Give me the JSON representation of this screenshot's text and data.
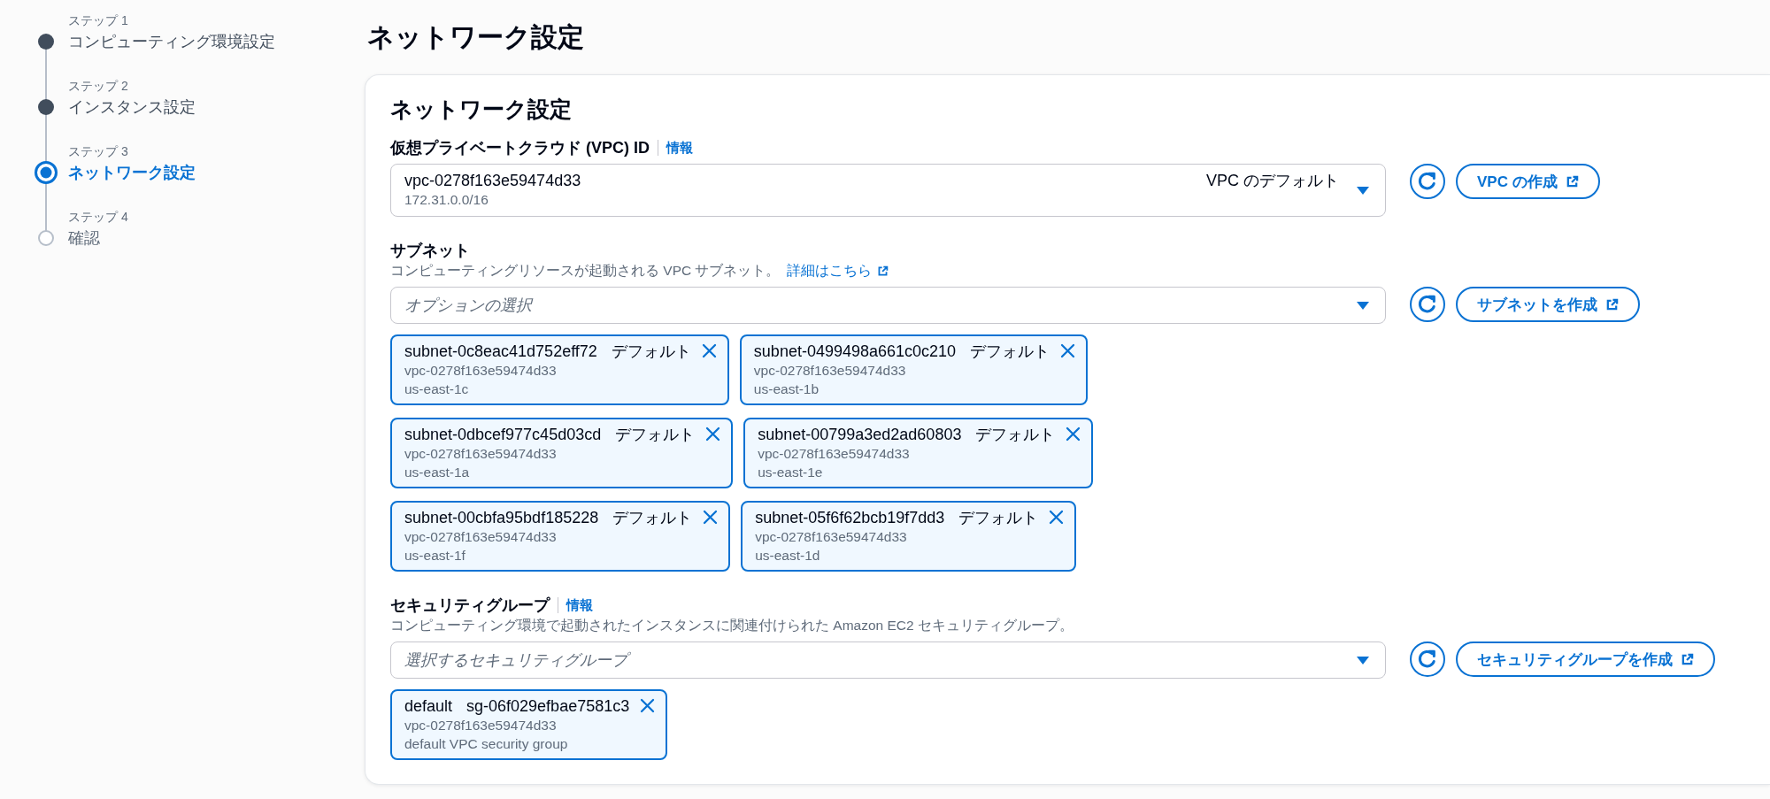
{
  "steps": [
    {
      "label": "ステップ 1",
      "title": "コンピューティング環境設定",
      "completed": true,
      "selected": false
    },
    {
      "label": "ステップ 2",
      "title": "インスタンス設定",
      "completed": true,
      "selected": false
    },
    {
      "label": "ステップ 3",
      "title": "ネットワーク設定",
      "completed": false,
      "selected": true
    },
    {
      "label": "ステップ 4",
      "title": "確認",
      "completed": false,
      "selected": false
    }
  ],
  "page_title": "ネットワーク設定",
  "panel": {
    "title": "ネットワーク設定",
    "fields": [
      {
        "label": "仮想プライベートクラウド (VPC) ID",
        "info_link": "情報",
        "select": {
          "value": "vpc-0278f163e59474d33",
          "value_description": "172.31.0.0/16",
          "value_tag": "VPC のデフォルト"
        },
        "create_button": "VPC の作成"
      },
      {
        "label": "サブネット",
        "description": "コンピューティングリソースが起動される VPC サブネット。",
        "description_link": "詳細はこちら",
        "select": {
          "placeholder": "オプションの選択"
        },
        "create_button": "サブネットを作成",
        "tokens": [
          {
            "label": "subnet-0c8eac41d752eff72",
            "tag": "デフォルト",
            "details": [
              "vpc-0278f163e59474d33",
              "us-east-1c"
            ]
          },
          {
            "label": "subnet-0499498a661c0c210",
            "tag": "デフォルト",
            "details": [
              "vpc-0278f163e59474d33",
              "us-east-1b"
            ]
          },
          {
            "label": "subnet-0dbcef977c45d03cd",
            "tag": "デフォルト",
            "details": [
              "vpc-0278f163e59474d33",
              "us-east-1a"
            ]
          },
          {
            "label": "subnet-00799a3ed2ad60803",
            "tag": "デフォルト",
            "details": [
              "vpc-0278f163e59474d33",
              "us-east-1e"
            ]
          },
          {
            "label": "subnet-00cbfa95bdf185228",
            "tag": "デフォルト",
            "details": [
              "vpc-0278f163e59474d33",
              "us-east-1f"
            ]
          },
          {
            "label": "subnet-05f6f62bcb19f7dd3",
            "tag": "デフォルト",
            "details": [
              "vpc-0278f163e59474d33",
              "us-east-1d"
            ]
          }
        ]
      },
      {
        "label": "セキュリティグループ",
        "info_link": "情報",
        "description": "コンピューティング環境で起動されたインスタンスに関連付けられた Amazon EC2 セキュリティグループ。",
        "select": {
          "placeholder": "選択するセキュリティグループ"
        },
        "create_button": "セキュリティグループを作成",
        "tokens": [
          {
            "label": "default",
            "tag": "sg-06f029efbae7581c3",
            "details": [
              "vpc-0278f163e59474d33",
              "default VPC security group"
            ]
          }
        ]
      }
    ]
  }
}
